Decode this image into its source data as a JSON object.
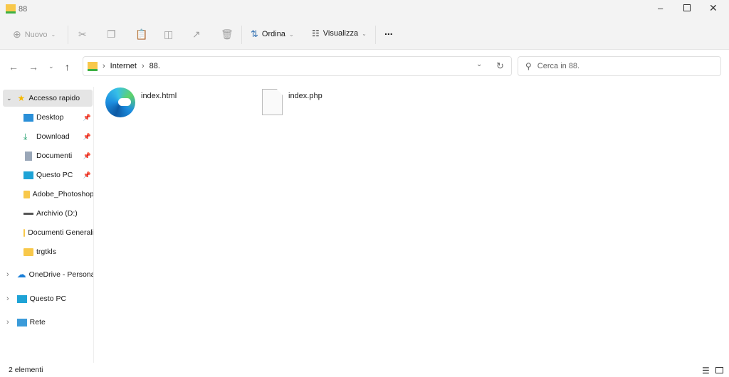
{
  "window": {
    "title": "88"
  },
  "toolbar": {
    "new": "Nuovo",
    "sort": "Ordina",
    "view": "Visualizza",
    "more": "..."
  },
  "address": {
    "crumbs": [
      "Internet",
      "88."
    ]
  },
  "search": {
    "placeholder": "Cerca in 88."
  },
  "sidebar": {
    "quick_access": "Accesso rapido",
    "pinned": [
      "Desktop",
      "Download",
      "Documenti",
      "Questo PC"
    ],
    "folders": [
      "Adobe_Photoshop",
      "Archivio (D:)",
      "Documenti Generali",
      "trgtkls"
    ],
    "onedrive": "OneDrive - Personal",
    "this_pc": "Questo PC",
    "network": "Rete"
  },
  "files": [
    {
      "name": "index.html",
      "icon": "edge-icon"
    },
    {
      "name": "index.php",
      "icon": "blank-file-icon"
    }
  ],
  "status": {
    "count": "2 elementi"
  }
}
